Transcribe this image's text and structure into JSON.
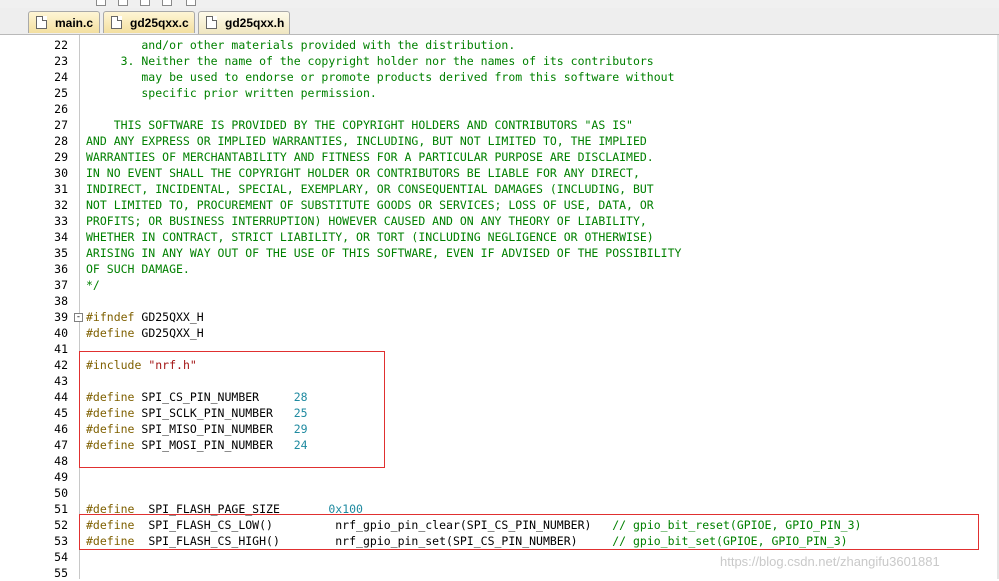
{
  "tabs": [
    {
      "label": "main.c",
      "active": false
    },
    {
      "label": "gd25qxx.c",
      "active": false
    },
    {
      "label": "gd25qxx.h",
      "active": true
    }
  ],
  "editor": {
    "lines": [
      {
        "n": "22",
        "parts": [
          {
            "t": "        and/or other materials provided with the distribution.",
            "c": "cm"
          }
        ]
      },
      {
        "n": "23",
        "parts": [
          {
            "t": "     3. Neither the name of the copyright holder nor the names of its contributors",
            "c": "cm"
          }
        ]
      },
      {
        "n": "24",
        "parts": [
          {
            "t": "        may be used to endorse or promote products derived from this software without",
            "c": "cm"
          }
        ]
      },
      {
        "n": "25",
        "parts": [
          {
            "t": "        specific prior written permission.",
            "c": "cm"
          }
        ]
      },
      {
        "n": "26",
        "parts": []
      },
      {
        "n": "27",
        "parts": [
          {
            "t": "    THIS SOFTWARE IS PROVIDED BY THE COPYRIGHT HOLDERS AND CONTRIBUTORS \"AS IS\"",
            "c": "cm"
          }
        ]
      },
      {
        "n": "28",
        "parts": [
          {
            "t": "AND ANY EXPRESS OR IMPLIED WARRANTIES, INCLUDING, BUT NOT LIMITED TO, THE IMPLIED",
            "c": "cm"
          }
        ]
      },
      {
        "n": "29",
        "parts": [
          {
            "t": "WARRANTIES OF MERCHANTABILITY AND FITNESS FOR A PARTICULAR PURPOSE ARE DISCLAIMED.",
            "c": "cm"
          }
        ]
      },
      {
        "n": "30",
        "parts": [
          {
            "t": "IN NO EVENT SHALL THE COPYRIGHT HOLDER OR CONTRIBUTORS BE LIABLE FOR ANY DIRECT,",
            "c": "cm"
          }
        ]
      },
      {
        "n": "31",
        "parts": [
          {
            "t": "INDIRECT, INCIDENTAL, SPECIAL, EXEMPLARY, OR CONSEQUENTIAL DAMAGES (INCLUDING, BUT",
            "c": "cm"
          }
        ]
      },
      {
        "n": "32",
        "parts": [
          {
            "t": "NOT LIMITED TO, PROCUREMENT OF SUBSTITUTE GOODS OR SERVICES; LOSS OF USE, DATA, OR",
            "c": "cm"
          }
        ]
      },
      {
        "n": "33",
        "parts": [
          {
            "t": "PROFITS; OR BUSINESS INTERRUPTION) HOWEVER CAUSED AND ON ANY THEORY OF LIABILITY,",
            "c": "cm"
          }
        ]
      },
      {
        "n": "34",
        "parts": [
          {
            "t": "WHETHER IN CONTRACT, STRICT LIABILITY, OR TORT (INCLUDING NEGLIGENCE OR OTHERWISE)",
            "c": "cm"
          }
        ]
      },
      {
        "n": "35",
        "parts": [
          {
            "t": "ARISING IN ANY WAY OUT OF THE USE OF THIS SOFTWARE, EVEN IF ADVISED OF THE POSSIBILITY",
            "c": "cm"
          }
        ]
      },
      {
        "n": "36",
        "parts": [
          {
            "t": "OF SUCH DAMAGE.",
            "c": "cm"
          }
        ]
      },
      {
        "n": "37",
        "parts": [
          {
            "t": "*/",
            "c": "cm"
          }
        ]
      },
      {
        "n": "38",
        "parts": []
      },
      {
        "n": "39",
        "fold": "-",
        "parts": [
          {
            "t": "#ifndef",
            "c": "pp"
          },
          {
            "t": " GD25QXX_H",
            "c": ""
          }
        ]
      },
      {
        "n": "40",
        "parts": [
          {
            "t": "#define",
            "c": "pp"
          },
          {
            "t": " GD25QXX_H",
            "c": ""
          }
        ]
      },
      {
        "n": "41",
        "parts": []
      },
      {
        "n": "42",
        "parts": [
          {
            "t": "#include",
            "c": "pp"
          },
          {
            "t": " ",
            "c": ""
          },
          {
            "t": "\"nrf.h\"",
            "c": "str"
          }
        ]
      },
      {
        "n": "43",
        "parts": []
      },
      {
        "n": "44",
        "parts": [
          {
            "t": "#define",
            "c": "pp"
          },
          {
            "t": " SPI_CS_PIN_NUMBER     ",
            "c": ""
          },
          {
            "t": "28",
            "c": "num"
          }
        ]
      },
      {
        "n": "45",
        "parts": [
          {
            "t": "#define",
            "c": "pp"
          },
          {
            "t": " SPI_SCLK_PIN_NUMBER   ",
            "c": ""
          },
          {
            "t": "25",
            "c": "num"
          }
        ]
      },
      {
        "n": "46",
        "parts": [
          {
            "t": "#define",
            "c": "pp"
          },
          {
            "t": " SPI_MISO_PIN_NUMBER   ",
            "c": ""
          },
          {
            "t": "29",
            "c": "num"
          }
        ]
      },
      {
        "n": "47",
        "parts": [
          {
            "t": "#define",
            "c": "pp"
          },
          {
            "t": " SPI_MOSI_PIN_NUMBER   ",
            "c": ""
          },
          {
            "t": "24",
            "c": "num"
          }
        ]
      },
      {
        "n": "48",
        "parts": []
      },
      {
        "n": "49",
        "parts": []
      },
      {
        "n": "50",
        "parts": []
      },
      {
        "n": "51",
        "parts": [
          {
            "t": "#define",
            "c": "pp"
          },
          {
            "t": "  SPI_FLASH_PAGE_SIZE       ",
            "c": ""
          },
          {
            "t": "0x100",
            "c": "num"
          }
        ]
      },
      {
        "n": "52",
        "parts": [
          {
            "t": "#define",
            "c": "pp"
          },
          {
            "t": "  SPI_FLASH_CS_LOW()         nrf_gpio_pin_clear(SPI_CS_PIN_NUMBER)   ",
            "c": ""
          },
          {
            "t": "// gpio_bit_reset(GPIOE, GPIO_PIN_3)",
            "c": "cm"
          }
        ]
      },
      {
        "n": "53",
        "parts": [
          {
            "t": "#define",
            "c": "pp"
          },
          {
            "t": "  SPI_FLASH_CS_HIGH()        nrf_gpio_pin_set(SPI_CS_PIN_NUMBER)     ",
            "c": ""
          },
          {
            "t": "// gpio_bit_set(GPIOE, GPIO_PIN_3)",
            "c": "cm"
          }
        ]
      },
      {
        "n": "54",
        "parts": []
      },
      {
        "n": "55",
        "parts": []
      }
    ]
  },
  "watermark": "https://blog.csdn.net/zhangifu3601881",
  "colors": {
    "comment": "#008000",
    "preprocessor": "#7f6000",
    "string": "#a31515",
    "number": "#1f8aa0",
    "highlight_box": "#e03030"
  }
}
